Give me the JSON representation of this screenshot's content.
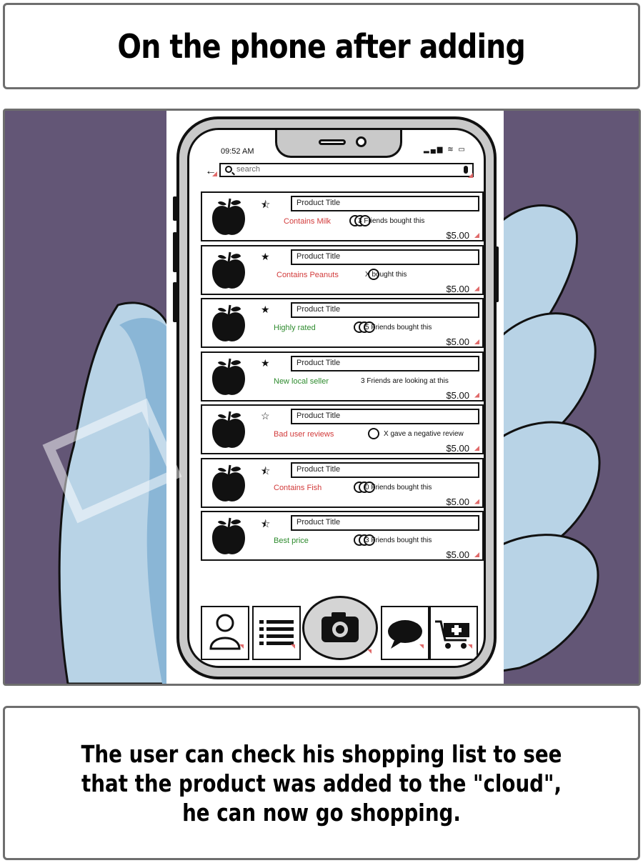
{
  "header": {
    "title": "On the phone after adding"
  },
  "phone": {
    "status_time": "09:52 AM",
    "search_placeholder": "search",
    "items": [
      {
        "title": "Product Title",
        "star": "half",
        "tag": "Contains Milk",
        "tag_color": "#d23b3b",
        "avatars": 3,
        "social": "3 Friends bought this",
        "price": "$5.00"
      },
      {
        "title": "Product Title",
        "star": "full",
        "tag": "Contains Peanuts",
        "tag_color": "#d23b3b",
        "avatars": 1,
        "social": "X bought this",
        "price": "$5.00"
      },
      {
        "title": "Product Title",
        "star": "full",
        "tag": "Highly rated",
        "tag_color": "#2e8b2e",
        "avatars": 3,
        "social": "5 Friends bought this",
        "price": "$5.00"
      },
      {
        "title": "Product Title",
        "star": "full",
        "tag": "New local seller",
        "tag_color": "#2e8b2e",
        "avatars": 0,
        "social": "3 Friends are looking at this",
        "price": "$5.00"
      },
      {
        "title": "Product Title",
        "star": "empty",
        "tag": "Bad user reviews",
        "tag_color": "#d23b3b",
        "avatars": 1,
        "social": "X gave a negative review",
        "price": "$5.00"
      },
      {
        "title": "Product Title",
        "star": "half",
        "tag": "Contains Fish",
        "tag_color": "#d23b3b",
        "avatars": 3,
        "social": "0 Friends bought this",
        "price": "$5.00"
      },
      {
        "title": "Product Title",
        "star": "half",
        "tag": "Best price",
        "tag_color": "#2e8b2e",
        "avatars": 3,
        "social": "3 Friends bought this",
        "price": "$5.00"
      }
    ],
    "nav_icons": [
      "user-icon",
      "list-icon",
      "camera-icon",
      "chat-icon",
      "add-to-cart-icon"
    ]
  },
  "caption": {
    "text": "The user can check his shopping list to see that the product was added to the \"cloud\", he can now go shopping."
  },
  "colors": {
    "scene_bg": "#635676",
    "hand": "#b8d3e6",
    "hand_shade": "#8ab6d6"
  }
}
